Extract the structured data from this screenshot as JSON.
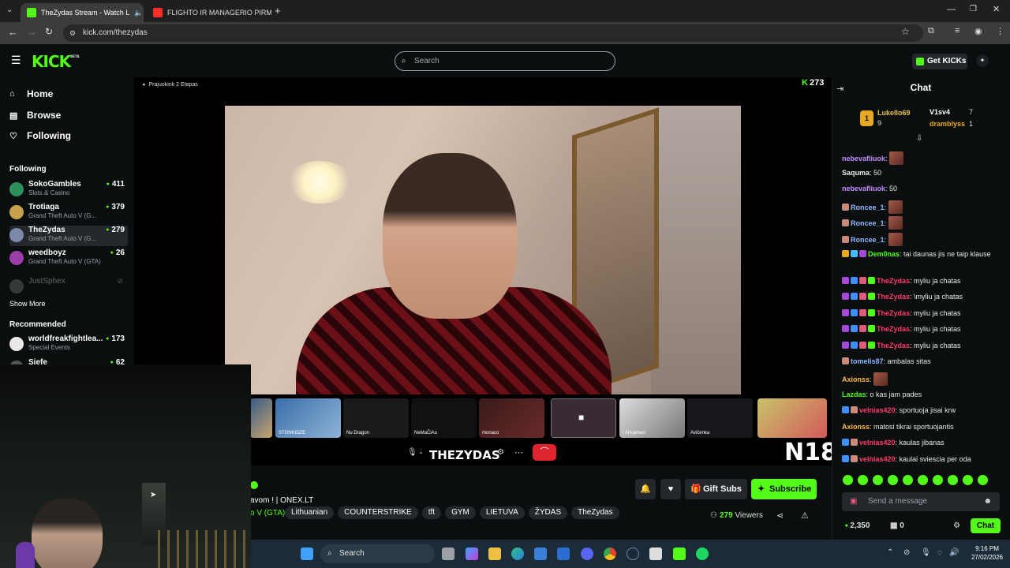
{
  "browser": {
    "tabs": [
      {
        "title": "TheZydas Stream - Watch L",
        "active": true
      },
      {
        "title": "FLIGHTO IR MANAGERIO PIRM",
        "active": false
      }
    ],
    "url": "kick.com/thezydas"
  },
  "kick": {
    "logo": "KICK",
    "logo_sup": "BETA",
    "search_placeholder": "Search",
    "get_kicks": "Get KICKs"
  },
  "sidebar": {
    "nav": [
      {
        "label": "Home",
        "icon": "home-icon"
      },
      {
        "label": "Browse",
        "icon": "browse-icon"
      },
      {
        "label": "Following",
        "icon": "heart-icon"
      }
    ],
    "following_header": "Following",
    "following": [
      {
        "name": "SokoGambles",
        "category": "Slots & Casino",
        "viewers": "411",
        "color": "#2f8f5a"
      },
      {
        "name": "Trotiaga",
        "category": "Grand Theft Auto V (G...",
        "viewers": "379",
        "color": "#c7a24a"
      },
      {
        "name": "TheZydas",
        "category": "Grand Theft Auto V (G...",
        "viewers": "279",
        "color": "#7a8aa8"
      },
      {
        "name": "weedboyz",
        "category": "Grand Theft Auto V (GTA)",
        "viewers": "26",
        "color": "#9b3ea8"
      }
    ],
    "offline": [
      {
        "name": "JustSphex"
      }
    ],
    "show_more": "Show More",
    "recommended_header": "Recommended",
    "recommended": [
      {
        "name": "worldfreakfightlea...",
        "category": "Special Events",
        "viewers": "173"
      },
      {
        "name": "Siefe",
        "category": "",
        "viewers": "62"
      }
    ]
  },
  "stream": {
    "video_title": "Prajuokink 2 Etapas",
    "viewer_overlay": "273",
    "brand_text": "THEZYDAS",
    "n18": "N18",
    "participants": [
      "STONKIDZE",
      "Nu Dragon",
      "NeMaČiAu",
      "monaco",
      "",
      "! Ahujenas!",
      "Avičenka",
      ""
    ],
    "title_fragment": "avom ! | ONEX.LT",
    "category_fragment": "o V (GTA)",
    "tags": [
      "Lithuanian",
      "COUNTERSTRIKE",
      "tft",
      "GYM",
      "LIETUVA",
      "ŽYDAS",
      "TheZydas"
    ],
    "viewers": "279",
    "viewers_label": "Viewers",
    "gift_subs": "Gift Subs",
    "subscribe": "Subscribe"
  },
  "chat": {
    "title": "Chat",
    "leaderboard": [
      {
        "rank": "1",
        "name": "Lukello69",
        "count": "9"
      },
      {
        "name": "V1sv4",
        "count": "7"
      },
      {
        "name": "dramblyss",
        "count": "1"
      }
    ],
    "messages": [
      {
        "user": "nebevafliuok",
        "color": "#c48cff",
        "text": "",
        "emote": true
      },
      {
        "user": "Saquma",
        "color": "#e8e8e8",
        "text": "50"
      },
      {
        "user": "nebevafliuok",
        "color": "#c48cff",
        "text": "50"
      },
      {
        "user": "Roncee_1",
        "color": "#8fb8ff",
        "text": "",
        "emote": true
      },
      {
        "user": "Roncee_1",
        "color": "#8fb8ff",
        "text": "",
        "emote": true
      },
      {
        "user": "Roncee_1",
        "color": "#8fb8ff",
        "text": "",
        "emote": true
      },
      {
        "user": "Dem0nas",
        "color": "#53fc18",
        "text": "tai daunas jis ne taip klause"
      },
      {
        "user": "TheZydas",
        "color": "#ff3b6b",
        "text": "myliu ja chatas"
      },
      {
        "user": "TheZydas",
        "color": "#ff3b6b",
        "text": "\\myliu ja chatas"
      },
      {
        "user": "TheZydas",
        "color": "#ff3b6b",
        "text": "myliu ja chatas"
      },
      {
        "user": "TheZydas",
        "color": "#ff3b6b",
        "text": "myliu ja chatas"
      },
      {
        "user": "TheZydas",
        "color": "#ff3b6b",
        "text": "myliu ja chatas"
      },
      {
        "user": "tomelis87",
        "color": "#8fb8ff",
        "text": "ambalas sitas"
      },
      {
        "user": "Axionss",
        "color": "#ffb84a",
        "text": "",
        "emote": true
      },
      {
        "user": "Lazdas",
        "color": "#53fc18",
        "text": "o kas jam pades"
      },
      {
        "user": "velnias420",
        "color": "#ff3b6b",
        "text": "sportuoja jisai krw"
      },
      {
        "user": "Axionss",
        "color": "#ffb84a",
        "text": "matosi tikrai sportuojantis"
      },
      {
        "user": "velnias420",
        "color": "#ff3b6b",
        "text": "kaulas jibanas"
      },
      {
        "user": "velnias420",
        "color": "#ff3b6b",
        "text": "kaulai sviescia per oda"
      }
    ],
    "send_placeholder": "Send a message",
    "points": "2,350",
    "gifts": "0",
    "chat_button": "Chat"
  },
  "taskbar": {
    "search": "Search",
    "time": "9:16 PM",
    "date": "27/02/2026"
  }
}
